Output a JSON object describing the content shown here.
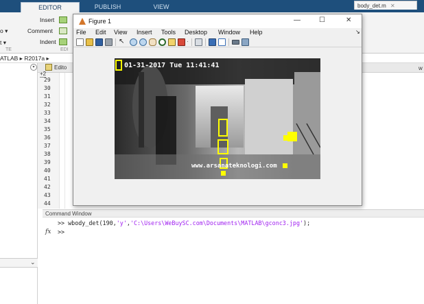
{
  "ribbon": {
    "tabs": [
      "EDITOR",
      "PUBLISH",
      "VIEW"
    ],
    "active_tab": "EDITOR",
    "items": {
      "insert": "Insert",
      "comment": "Comment",
      "indent": "Indent",
      "left_edit_trunc": "o ▾",
      "left_text_trunc": "t ▾",
      "group_left": "TE",
      "group_edit": "EDI"
    }
  },
  "address": {
    "root": "ATLAB",
    "sep": "▸",
    "folder": "R2017a",
    "more": "▸"
  },
  "editor": {
    "header_trunc": "Edito",
    "tab_plus": "+2",
    "right_tab": "body_det.m",
    "right_tab_close": "✕",
    "right_tab_extra": "w",
    "line_numbers": [
      "29",
      "30",
      "31",
      "32",
      "33",
      "34",
      "35",
      "36",
      "37",
      "38",
      "39",
      "40",
      "41",
      "42",
      "43",
      "44"
    ]
  },
  "command_window": {
    "title": "Command Window",
    "prompt": ">>",
    "fx": "fx",
    "cmd_fn": "wbody_det(190,",
    "cmd_arg1": "'y'",
    "cmd_comma": ",",
    "cmd_arg2": "'C:\\Users\\WeBuySC.com\\Documents\\MATLAB\\gconc3.jpg'",
    "cmd_end": ");"
  },
  "figure": {
    "title": "Figure 1",
    "controls": {
      "minimize": "—",
      "maximize": "☐",
      "close": "✕"
    },
    "menu": [
      "File",
      "Edit",
      "View",
      "Insert",
      "Tools",
      "Desktop",
      "Window",
      "Help"
    ],
    "menu_arrow": "↘",
    "image": {
      "timestamp": "01-31-2017 Tue 11:41:41",
      "watermark": "www.arsanateknologi.com"
    }
  },
  "colors": {
    "ribbon_blue": "#1e4f7c",
    "detection_yellow": "#ffff00",
    "string_purple": "#a020f0"
  },
  "icons": [
    "insert-icon",
    "comment-icon",
    "indent-icon",
    "matlab-figure-icon",
    "new-figure-icon",
    "open-icon",
    "save-icon",
    "print-icon",
    "pointer-icon",
    "zoom-in-icon",
    "zoom-out-icon",
    "pan-icon",
    "rotate-icon",
    "data-cursor-icon",
    "brush-icon",
    "link-icon",
    "colorbar-icon",
    "legend-icon",
    "hide-plot-tools-icon",
    "show-plot-tools-icon"
  ]
}
